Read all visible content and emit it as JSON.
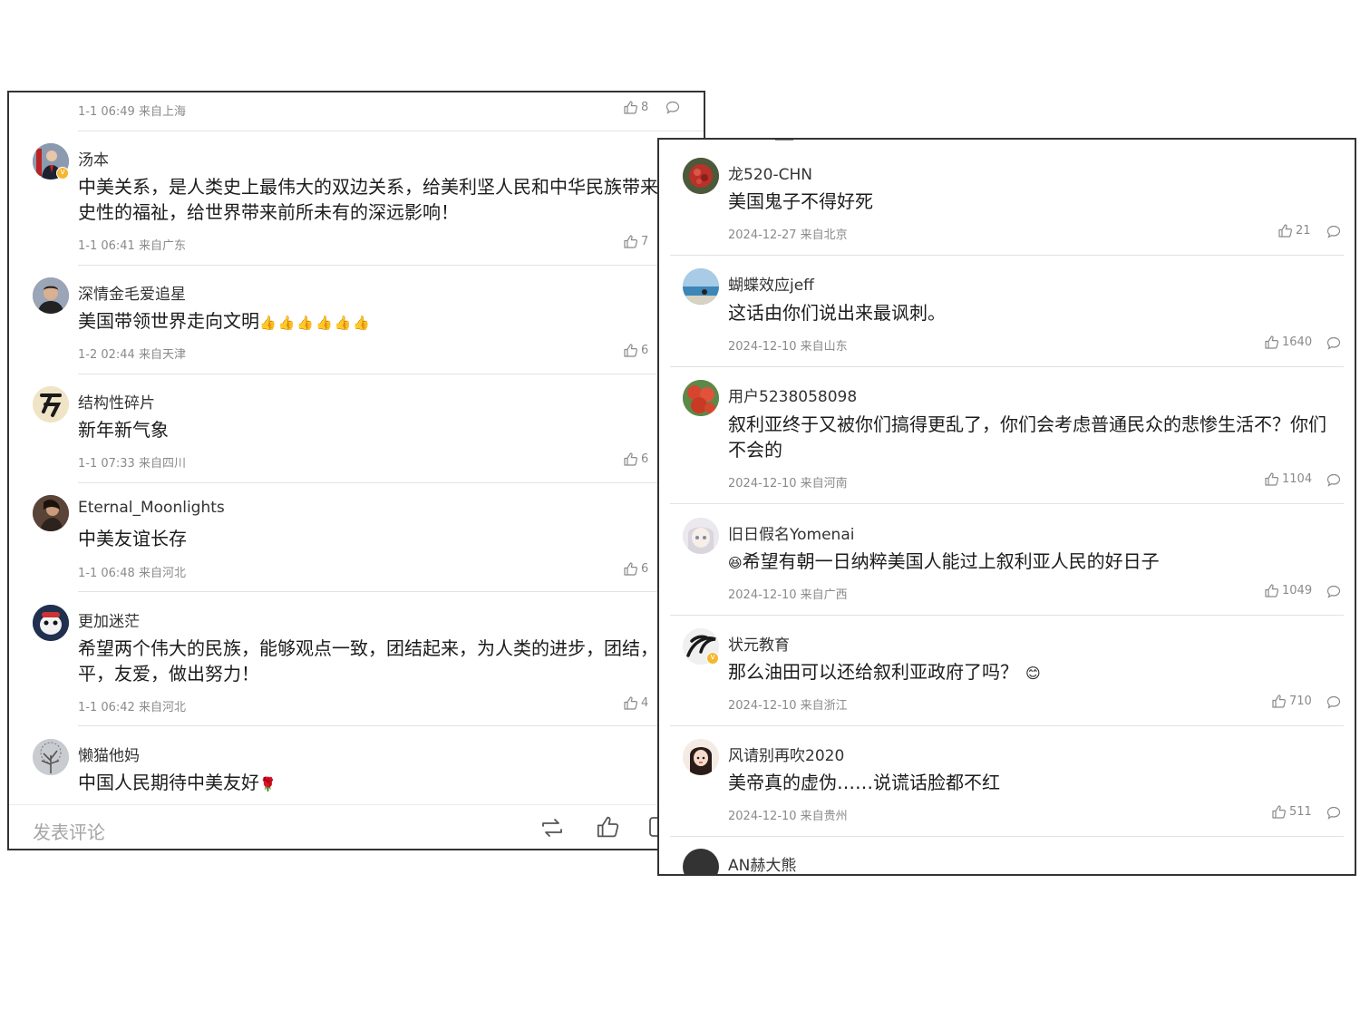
{
  "left_panel": {
    "top_meta": {
      "time": "1-1 06:49 来自上海",
      "likes": "8"
    },
    "comments": [
      {
        "user": "汤本",
        "lines": [
          "中美关系，是人类史上最伟大的双边关系，给美利坚人民和中华民族带来历",
          "史性的福祉，给世界带来前所未有的深远影响！"
        ],
        "time": "1-1 06:41 来自广东",
        "likes": "7"
      },
      {
        "user": "深情金毛爱追星",
        "lines": [
          "美国带领世界走向文明"
        ],
        "emoji": "👍👍👍👍👍👍",
        "time": "1-2 02:44 来自天津",
        "likes": "6"
      },
      {
        "user": "结构性碎片",
        "lines": [
          "新年新气象"
        ],
        "time": "1-1 07:33 来自四川",
        "likes": "6"
      },
      {
        "user": "Eternal_Moonlights",
        "lines": [
          "中美友谊长存"
        ],
        "time": "1-1 06:48 来自河北",
        "likes": "6"
      },
      {
        "user": "更加迷茫",
        "lines": [
          "希望两个伟大的民族，能够观点一致，团结起来，为人类的进步，团结，和",
          "平，友爱，做出努力！"
        ],
        "time": "1-1 06:42 来自河北",
        "likes": "4"
      },
      {
        "user": "懒猫他妈",
        "lines": [
          "中国人民期待中美友好"
        ],
        "emoji": "🌹"
      }
    ],
    "bottom_bar": {
      "placeholder": "发表评论"
    }
  },
  "right_panel": {
    "comments": [
      {
        "user": "龙520-CHN",
        "lines": [
          "美国鬼子不得好死"
        ],
        "time": "2024-12-27 来自北京",
        "likes": "21"
      },
      {
        "user": "蝴蝶效应jeff",
        "lines": [
          "这话由你们说出来最讽刺。"
        ],
        "time": "2024-12-10 来自山东",
        "likes": "1640"
      },
      {
        "user": "用户5238058098",
        "lines": [
          "叙利亚终于又被你们搞得更乱了，你们会考虑普通民众的悲惨生活不？你们",
          "不会的"
        ],
        "time": "2024-12-10 来自河南",
        "likes": "1104"
      },
      {
        "user": "旧日假名Yomenai",
        "lines": [
          "希望有朝一日纳粹美国人能过上叙利亚人民的好日子"
        ],
        "emoji_prefix": "😆",
        "time": "2024-12-10 来自广西",
        "likes": "1049"
      },
      {
        "user": "状元教育",
        "lines": [
          "那么油田可以还给叙利亚政府了吗？"
        ],
        "emoji": "😊",
        "time": "2024-12-10 来自浙江",
        "likes": "710"
      },
      {
        "user": "风请别再吹2020",
        "lines": [
          "美帝真的虚伪……说谎话脸都不红"
        ],
        "time": "2024-12-10 来自贵州",
        "likes": "511"
      },
      {
        "user": "AN赫大熊"
      }
    ]
  }
}
